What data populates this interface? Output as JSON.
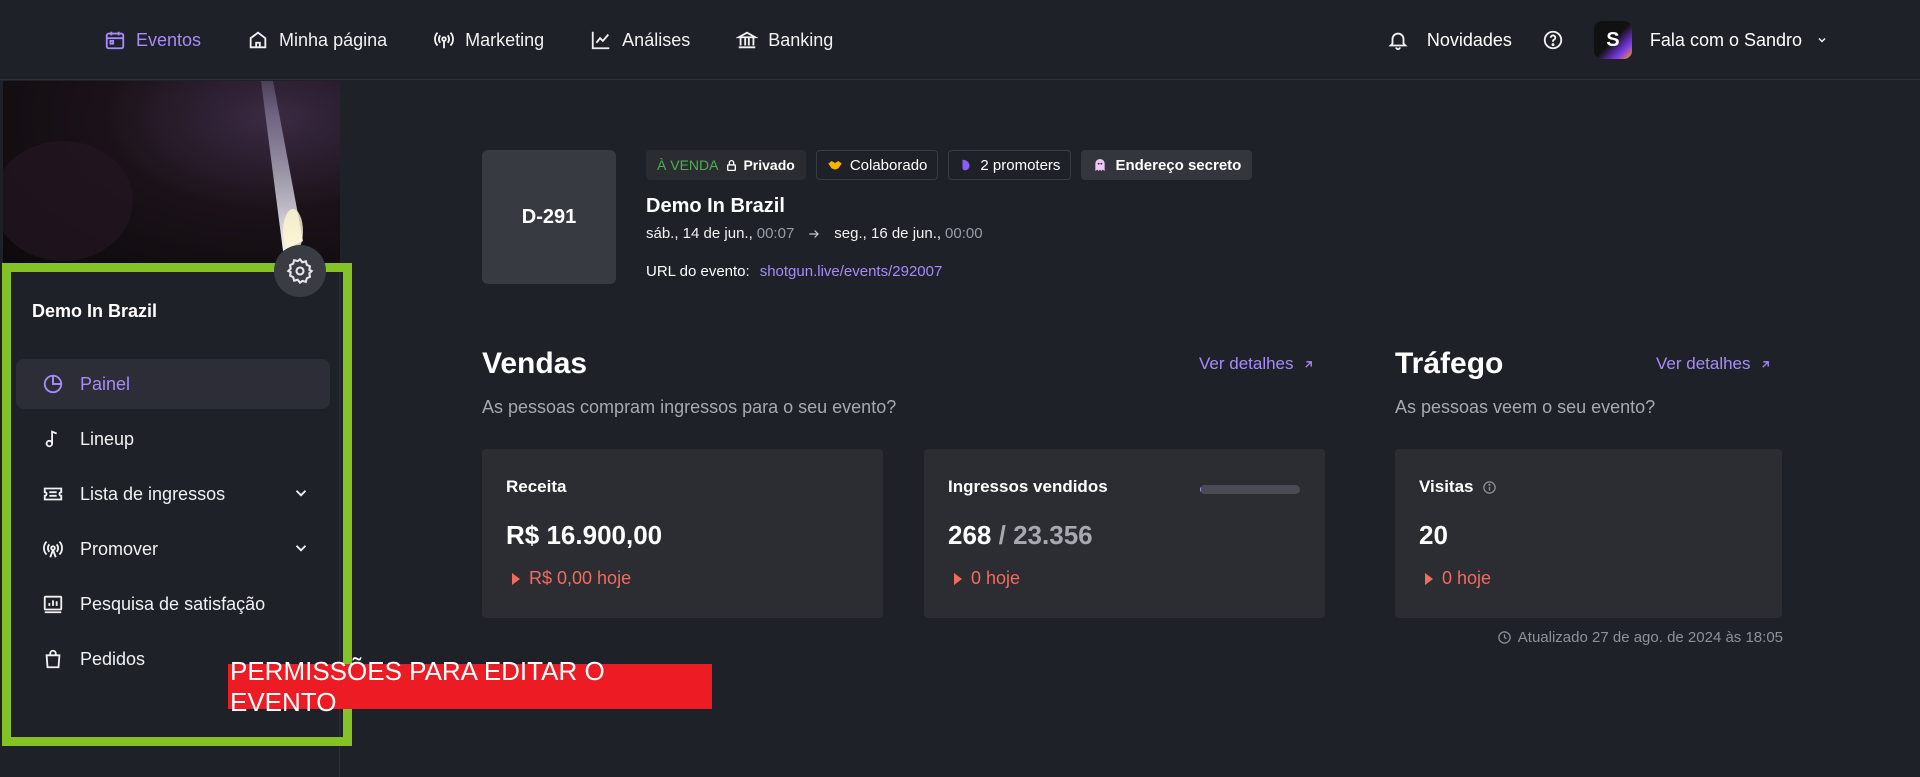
{
  "nav": {
    "items": [
      {
        "label": "Eventos",
        "icon": "calendar-icon",
        "active": true
      },
      {
        "label": "Minha página",
        "icon": "home-icon"
      },
      {
        "label": "Marketing",
        "icon": "broadcast-icon"
      },
      {
        "label": "Análises",
        "icon": "chart-line-icon"
      },
      {
        "label": "Banking",
        "icon": "bank-icon"
      }
    ],
    "news_label": "Novidades",
    "avatar_letter": "S",
    "user_label": "Fala com o Sandro"
  },
  "sidebar": {
    "event_name": "Demo In Brazil",
    "menu": [
      {
        "label": "Painel",
        "icon": "pie-chart-icon",
        "active": true
      },
      {
        "label": "Lineup",
        "icon": "music-note-icon"
      },
      {
        "label": "Lista de ingressos",
        "icon": "ticket-icon",
        "expandable": true
      },
      {
        "label": "Promover",
        "icon": "broadcast-icon",
        "expandable": true
      },
      {
        "label": "Pesquisa de satisfação",
        "icon": "survey-icon"
      },
      {
        "label": "Pedidos",
        "icon": "bag-icon"
      }
    ]
  },
  "annotation": {
    "banner_text": "PERMISSÕES PARA EDITAR O EVENTO",
    "frame_color": "#84c225",
    "banner_color": "#ed1c24"
  },
  "event": {
    "code": "D-291",
    "badges": {
      "sale": "À VENDA",
      "private": "Privado",
      "collab": "Colaborado",
      "promoters": "2 promoters",
      "secret": "Endereço secreto"
    },
    "title": "Demo In Brazil",
    "start_date": "sáb., 14 de jun.,",
    "start_time": "00:07",
    "end_date": "seg., 16 de jun.,",
    "end_time": "00:00",
    "url_label": "URL do evento:",
    "url": "shotgun.live/events/292007"
  },
  "sales": {
    "title": "Vendas",
    "subtitle": "As pessoas compram ingressos para o seu evento?",
    "details_label": "Ver detalhes",
    "revenue": {
      "label": "Receita",
      "value": "R$ 16.900,00",
      "today": "R$ 0,00 hoje"
    },
    "tickets": {
      "label": "Ingressos vendidos",
      "sold": "268",
      "separator": "/",
      "total": "23.356",
      "today": "0 hoje",
      "progress_fraction": 0.0115
    }
  },
  "traffic": {
    "title": "Tráfego",
    "subtitle": "As pessoas veem o seu evento?",
    "details_label": "Ver detalhes",
    "visits": {
      "label": "Visitas",
      "value": "20",
      "today": "0 hoje"
    }
  },
  "updated_text": "Atualizado 27 de ago. de 2024 às 18:05",
  "colors": {
    "accent": "#a78bfa",
    "negative": "#f26b5b",
    "sale_green": "#4caf50",
    "background": "#1f2128",
    "card": "#2c2d32"
  }
}
